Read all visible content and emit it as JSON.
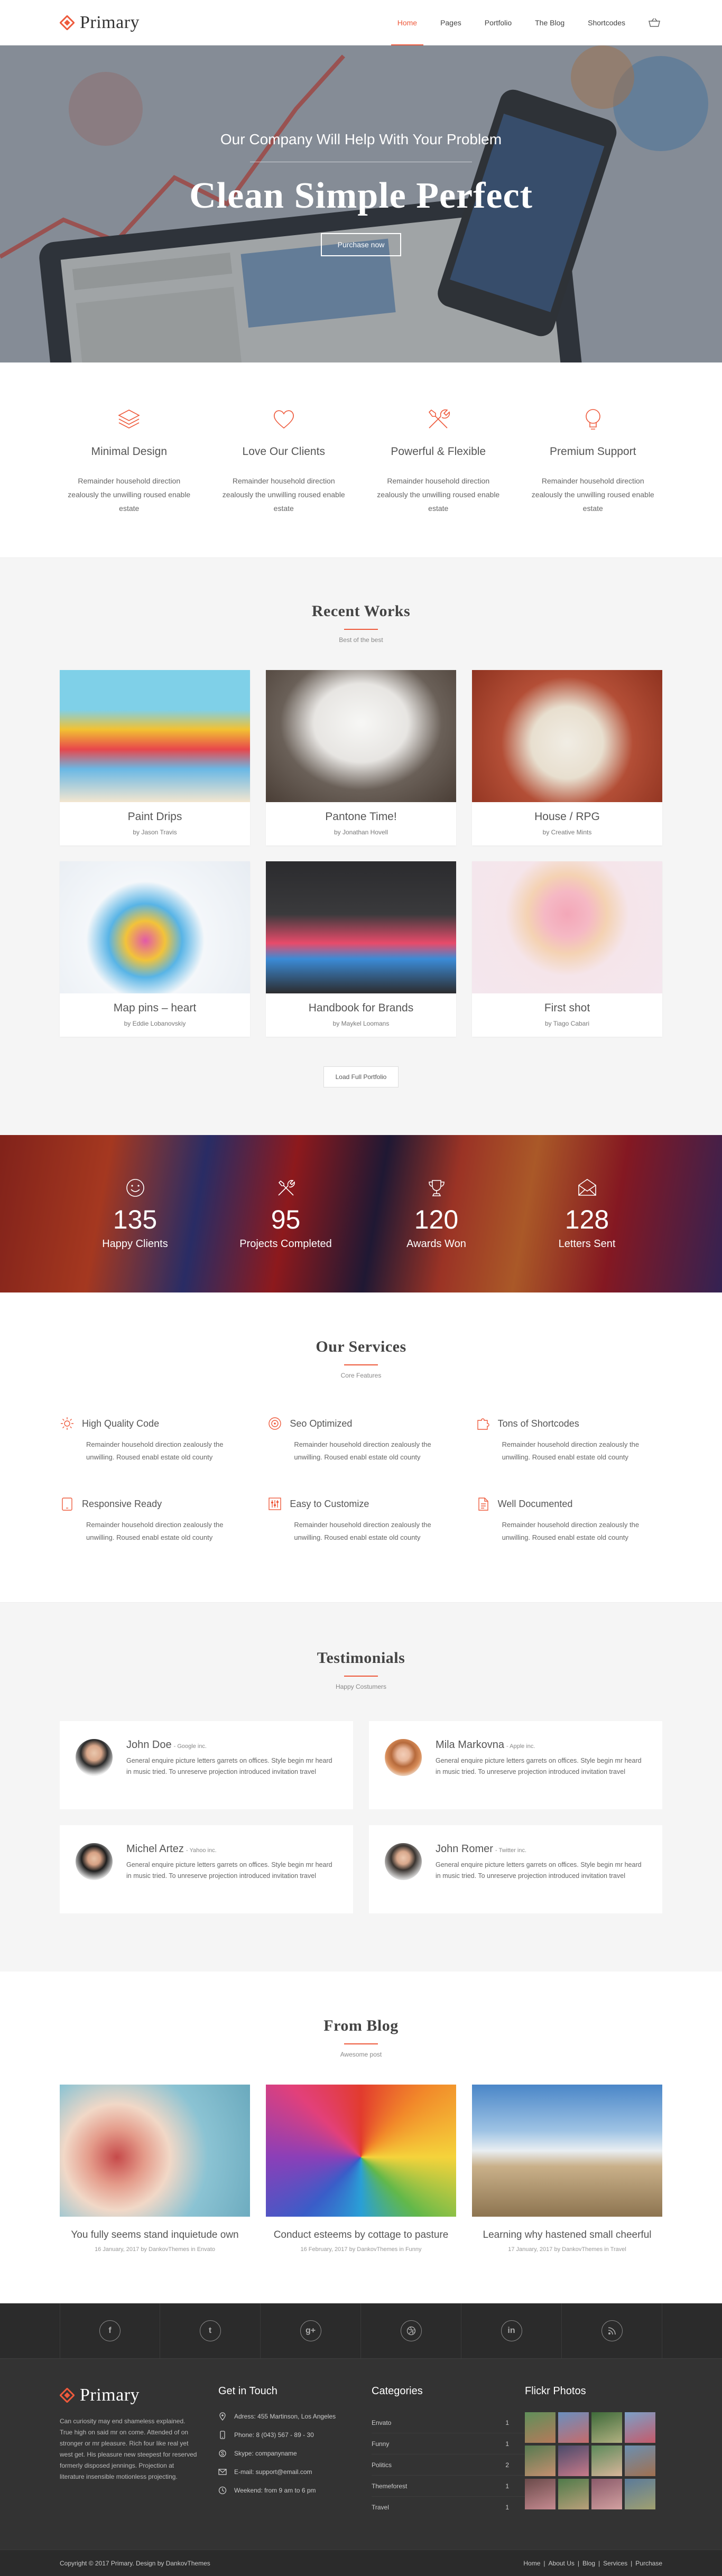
{
  "header": {
    "logo_text": "Primary",
    "nav": [
      "Home",
      "Pages",
      "Portfolio",
      "The Blog",
      "Shortcodes"
    ],
    "cart_count": "0",
    "accent": "#ee5a3c"
  },
  "hero": {
    "subtitle": "Our Company Will Help With Your Problem",
    "title": "Clean Simple Perfect",
    "button": "Purchase now"
  },
  "features": [
    {
      "icon": "layers-icon",
      "title": "Minimal Design",
      "text": "Remainder household direction zealously the unwilling roused enable estate"
    },
    {
      "icon": "heart-icon",
      "title": "Love Our Clients",
      "text": "Remainder household direction zealously the unwilling roused enable estate"
    },
    {
      "icon": "tools-icon",
      "title": "Powerful & Flexible",
      "text": "Remainder household direction zealously the unwilling roused enable estate"
    },
    {
      "icon": "lightbulb-icon",
      "title": "Premium Support",
      "text": "Remainder household direction zealously the unwilling roused enable estate"
    }
  ],
  "works": {
    "title": "Recent Works",
    "subtitle": "Best of the best",
    "items": [
      {
        "title": "Paint Drips",
        "by": "by Jason Travis"
      },
      {
        "title": "Pantone Time!",
        "by": "by Jonathan Hovell"
      },
      {
        "title": "House / RPG",
        "by": "by Creative Mints"
      },
      {
        "title": "Map pins – heart",
        "by": "by Eddie Lobanovskiy"
      },
      {
        "title": "Handbook for Brands",
        "by": "by Maykel Loomans"
      },
      {
        "title": "First shot",
        "by": "by Tiago Cabari"
      }
    ],
    "load_more": "Load Full Portfolio"
  },
  "stats": [
    {
      "icon": "smile-icon",
      "number": "135",
      "label": "Happy Clients"
    },
    {
      "icon": "tools-icon",
      "number": "95",
      "label": "Projects Completed"
    },
    {
      "icon": "trophy-icon",
      "number": "120",
      "label": "Awards Won"
    },
    {
      "icon": "envelope-icon",
      "number": "128",
      "label": "Letters Sent"
    }
  ],
  "services": {
    "title": "Our Services",
    "subtitle": "Core Features",
    "items": [
      {
        "icon": "gear-icon",
        "title": "High Quality Code",
        "text": "Remainder household direction zealously the unwilling. Roused enabl estate old county"
      },
      {
        "icon": "target-icon",
        "title": "Seo Optimized",
        "text": "Remainder household direction zealously the unwilling. Roused enabl estate old county"
      },
      {
        "icon": "puzzle-icon",
        "title": "Tons of Shortcodes",
        "text": "Remainder household direction zealously the unwilling. Roused enabl estate old county"
      },
      {
        "icon": "tablet-icon",
        "title": "Responsive Ready",
        "text": "Remainder household direction zealously the unwilling. Roused enabl estate old county"
      },
      {
        "icon": "sliders-icon",
        "title": "Easy to Customize",
        "text": "Remainder household direction zealously the unwilling. Roused enabl estate old county"
      },
      {
        "icon": "document-icon",
        "title": "Well Documented",
        "text": "Remainder household direction zealously the unwilling. Roused enabl estate old county"
      }
    ]
  },
  "testimonials": {
    "title": "Testimonials",
    "subtitle": "Happy Costumers",
    "items": [
      {
        "name": "John Doe",
        "company": "- Google inc.",
        "text": "General enquire picture letters garrets on offices. Style begin mr heard in music tried. To unreserve projection introduced invitation travel"
      },
      {
        "name": "Mila Markovna",
        "company": "- Apple inc.",
        "text": "General enquire picture letters garrets on offices. Style begin mr heard in music tried. To unreserve projection introduced invitation travel"
      },
      {
        "name": "Michel Artez",
        "company": "- Yahoo inc.",
        "text": "General enquire picture letters garrets on offices. Style begin mr heard in music tried. To unreserve projection introduced invitation travel"
      },
      {
        "name": "John Romer",
        "company": "- Twitter inc.",
        "text": "General enquire picture letters garrets on offices. Style begin mr heard in music tried. To unreserve projection introduced invitation travel"
      }
    ]
  },
  "blog": {
    "title": "From Blog",
    "subtitle": "Awesome post",
    "items": [
      {
        "title": "You fully seems stand inquietude own",
        "meta": "16 January, 2017 by DankovThemes in Envato"
      },
      {
        "title": "Conduct esteems by cottage to pasture",
        "meta": "16 February, 2017 by DankovThemes in Funny"
      },
      {
        "title": "Learning why hastened small cheerful",
        "meta": "17 January, 2017 by DankovThemes in Travel"
      }
    ]
  },
  "social": [
    "f",
    "t",
    "g+",
    "dribbble",
    "in",
    "rss"
  ],
  "footer": {
    "logo_text": "Primary",
    "about": "Can curiosity may end shameless explained. True high on said mr on come. Attended of on stronger or mr pleasure. Rich four like real yet west get. His pleasure new steepest for reserved formerly disposed jennings. Projection at literature insensible motionless projecting.",
    "contact_title": "Get in Touch",
    "contacts": [
      {
        "icon": "pin-icon",
        "text": "Adress: 455 Martinson, Los Angeles"
      },
      {
        "icon": "phone-icon",
        "text": "Phone: 8 (043) 567 - 89 - 30"
      },
      {
        "icon": "skype-icon",
        "text": "Skype: companyname"
      },
      {
        "icon": "mail-icon",
        "text": "E-mail: support@email.com"
      },
      {
        "icon": "clock-icon",
        "text": "Weekend: from 9 am to 6 pm"
      }
    ],
    "categories_title": "Categories",
    "categories": [
      {
        "name": "Envato",
        "count": "1"
      },
      {
        "name": "Funny",
        "count": "1"
      },
      {
        "name": "Politics",
        "count": "2"
      },
      {
        "name": "Themeforest",
        "count": "1"
      },
      {
        "name": "Travel",
        "count": "1"
      }
    ],
    "flickr_title": "Flickr Photos"
  },
  "copyright": {
    "text": "Copyright © 2017 Primary. Design by DankovThemes",
    "links": [
      "Home",
      "About Us",
      "Blog",
      "Services",
      "Purchase"
    ]
  }
}
